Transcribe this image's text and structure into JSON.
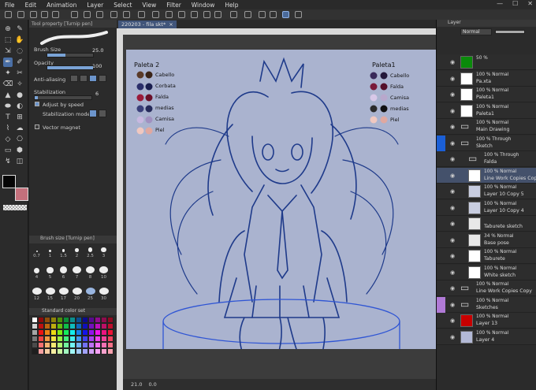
{
  "menu": [
    "File",
    "Edit",
    "Animation",
    "Layer",
    "Select",
    "View",
    "Filter",
    "Window",
    "Help"
  ],
  "tool_property": {
    "header": "Tool property [Turnip pen]",
    "brush_size_label": "Brush Size",
    "brush_size_value": "25.0",
    "opacity_label": "Opacity",
    "opacity_value": "100",
    "opacity_fraction": 1.0,
    "anti_aliasing_label": "Anti-aliasing",
    "stabilization_label": "Stabilization",
    "stabilization_value": "6",
    "adjust_speed_label": "Adjust by speed",
    "stab_mode_label": "Stabilization mode",
    "vector_magnet_label": "Vector magnet"
  },
  "brush_size_panel": {
    "header": "Brush size [Turnip pen]",
    "sizes": [
      "0.7",
      "1",
      "1.5",
      "2",
      "2.5",
      "3",
      "4",
      "5",
      "6",
      "7",
      "8",
      "10",
      "12",
      "15",
      "17",
      "20",
      "25",
      "30"
    ]
  },
  "color_set": {
    "label": "Standard color set"
  },
  "document": {
    "tab": "220203 - fila skt*",
    "zoom": "21.0",
    "angle": "0.0"
  },
  "canvas_text": {
    "paleta2_title": "Paleta 2",
    "paleta2_items": [
      "Cabello",
      "Corbata",
      "Falda",
      "medias",
      "Camisa",
      "Piel"
    ],
    "paleta1_title": "Paleta1",
    "paleta1_items": [
      "Cabello",
      "Falda",
      "Camisa",
      "medias",
      "Piel"
    ]
  },
  "layers_panel": {
    "header": "Layer",
    "blend_mode": "Normal",
    "layers": [
      {
        "l1": "50 %",
        "l2": "",
        "thumb": "#0a8a0a",
        "kind": "fill"
      },
      {
        "l1": "100 % Normal",
        "l2": "Pa.xta",
        "thumb": "#ffffff",
        "kind": "raster"
      },
      {
        "l1": "100 % Normal",
        "l2": "Paleta1",
        "thumb": "#ffffff",
        "kind": "raster"
      },
      {
        "l1": "100 % Normal",
        "l2": "Paleta1",
        "thumb": "#ffffff",
        "kind": "raster"
      },
      {
        "l1": "100 % Normal",
        "l2": "Main Drawing",
        "thumb": "",
        "kind": "folder"
      },
      {
        "l1": "100 % Through",
        "l2": "Sketch",
        "thumb": "",
        "kind": "folder"
      },
      {
        "l1": "100 % Through",
        "l2": "Falda",
        "thumb": "",
        "kind": "folder"
      },
      {
        "l1": "100 % Normal",
        "l2": "Line Work Copies Copy 2",
        "thumb": "#ffffff",
        "kind": "raster",
        "selected": true
      },
      {
        "l1": "100 % Normal",
        "l2": "Layer 10 Copy 5",
        "thumb": "#c8cde0",
        "kind": "raster"
      },
      {
        "l1": "100 % Normal",
        "l2": "Layer 10 Copy 4",
        "thumb": "#c8cde0",
        "kind": "raster"
      },
      {
        "l1": "",
        "l2": "Taburete sketch",
        "thumb": "#e8e8e8",
        "kind": "raster"
      },
      {
        "l1": "34 % Normal",
        "l2": "Base pose",
        "thumb": "#e8e8e8",
        "kind": "raster"
      },
      {
        "l1": "100 % Normal",
        "l2": "Taburete",
        "thumb": "#ffffff",
        "kind": "raster"
      },
      {
        "l1": "100 % Normal",
        "l2": "White sketch",
        "thumb": "#ffffff",
        "kind": "raster"
      },
      {
        "l1": "100 % Normal",
        "l2": "Line Work Copies Copy",
        "thumb": "",
        "kind": "folder"
      },
      {
        "l1": "100 % Normal",
        "l2": "Sketches",
        "thumb": "",
        "kind": "folder"
      },
      {
        "l1": "100 % Normal",
        "l2": "Layer 13",
        "thumb": "#c80000",
        "kind": "fill"
      },
      {
        "l1": "100 % Normal",
        "l2": "Layer 4",
        "thumb": "#b3b9d6",
        "kind": "fill"
      }
    ]
  }
}
